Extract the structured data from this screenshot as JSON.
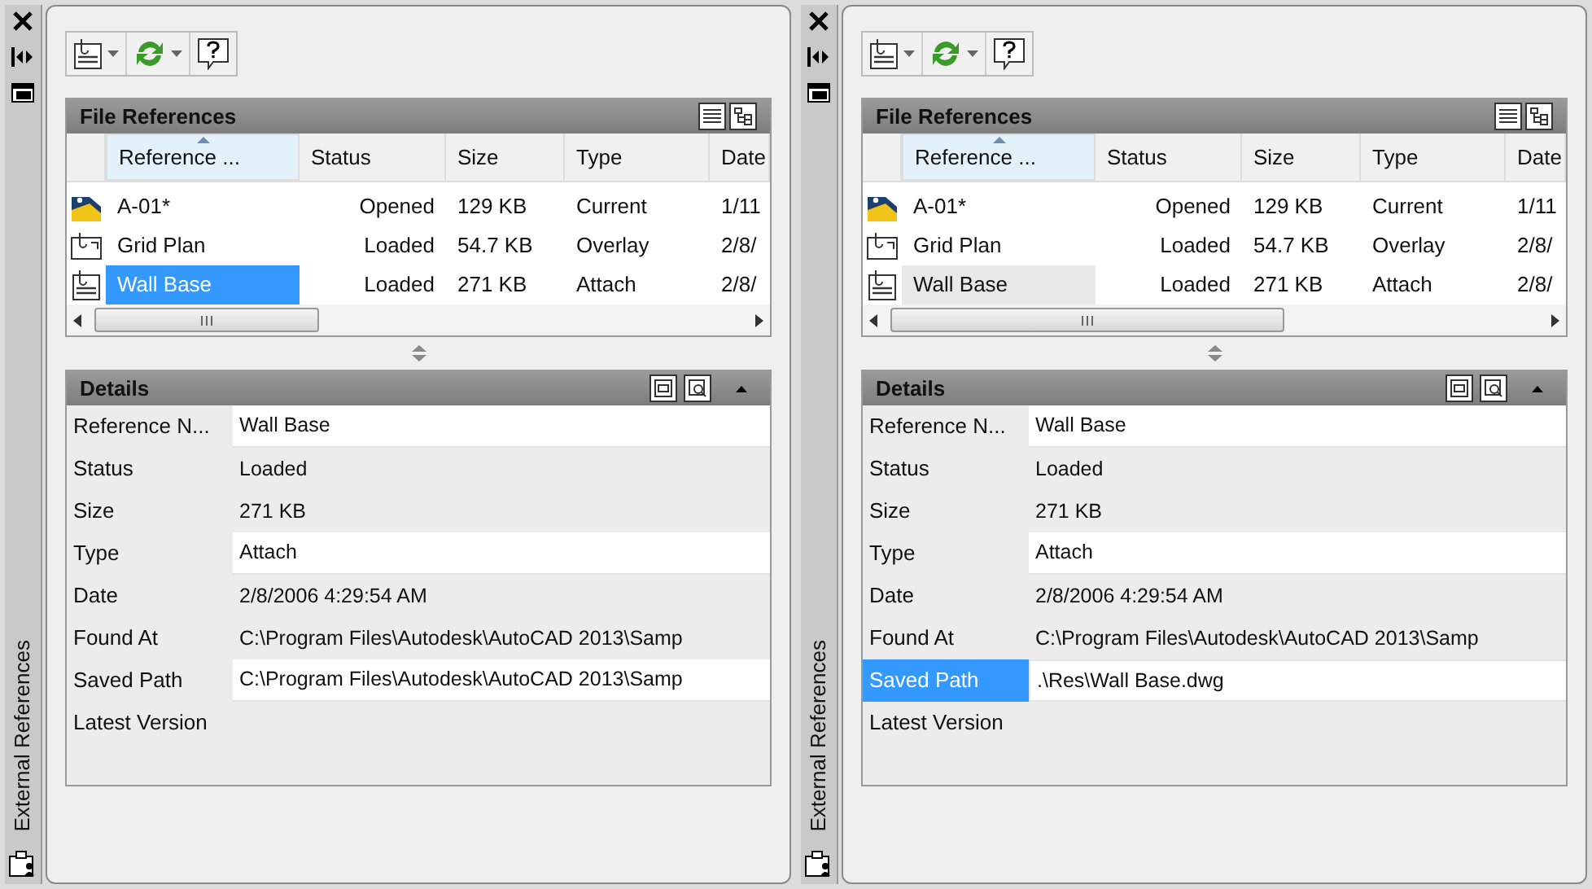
{
  "panels": [
    {
      "strip_title": "External References",
      "file_references": {
        "title": "File References",
        "focused": true,
        "columns": [
          "Reference ...",
          "Status",
          "Size",
          "Type",
          "Date"
        ],
        "rows": [
          {
            "kind": "current",
            "cells": [
              "A-01*",
              "Opened",
              "129 KB",
              "Current",
              "1/11"
            ],
            "selected": false
          },
          {
            "kind": "overlay",
            "cells": [
              "Grid Plan",
              "Loaded",
              "54.7 KB",
              "Overlay",
              "2/8/"
            ],
            "selected": false
          },
          {
            "kind": "attach",
            "cells": [
              "Wall Base",
              "Loaded",
              "271 KB",
              "Attach",
              "2/8/"
            ],
            "selected": true
          }
        ]
      },
      "details": {
        "title": "Details",
        "rows": [
          {
            "label": "Reference N...",
            "value": "Wall Base",
            "editable": true,
            "selected": false
          },
          {
            "label": "Status",
            "value": "Loaded",
            "editable": false,
            "selected": false
          },
          {
            "label": "Size",
            "value": "271 KB",
            "editable": false,
            "selected": false
          },
          {
            "label": "Type",
            "value": "Attach",
            "editable": true,
            "selected": false
          },
          {
            "label": "Date",
            "value": "2/8/2006 4:29:54 AM",
            "editable": false,
            "selected": false
          },
          {
            "label": "Found At",
            "value": "C:\\Program Files\\Autodesk\\AutoCAD 2013\\Samp",
            "editable": false,
            "selected": false
          },
          {
            "label": "Saved Path",
            "value": "C:\\Program Files\\Autodesk\\AutoCAD 2013\\Samp",
            "editable": true,
            "selected": false
          },
          {
            "label": "Latest Version",
            "editable": false,
            "selected": false
          }
        ]
      }
    },
    {
      "strip_title": "External References",
      "file_references": {
        "title": "File References",
        "focused": false,
        "columns": [
          "Reference ...",
          "Status",
          "Size",
          "Type",
          "Date"
        ],
        "rows": [
          {
            "kind": "current",
            "cells": [
              "A-01*",
              "Opened",
              "129 KB",
              "Current",
              "1/11"
            ],
            "selected": false
          },
          {
            "kind": "overlay",
            "cells": [
              "Grid Plan",
              "Loaded",
              "54.7 KB",
              "Overlay",
              "2/8/"
            ],
            "selected": false
          },
          {
            "kind": "attach",
            "cells": [
              "Wall Base",
              "Loaded",
              "271 KB",
              "Attach",
              "2/8/"
            ],
            "selected": true
          }
        ]
      },
      "details": {
        "title": "Details",
        "rows": [
          {
            "label": "Reference N...",
            "value": "Wall Base",
            "editable": true,
            "selected": false
          },
          {
            "label": "Status",
            "value": "Loaded",
            "editable": false,
            "selected": false
          },
          {
            "label": "Size",
            "value": "271 KB",
            "editable": false,
            "selected": false
          },
          {
            "label": "Type",
            "value": "Attach",
            "editable": true,
            "selected": false
          },
          {
            "label": "Date",
            "value": "2/8/2006 4:29:54 AM",
            "editable": false,
            "selected": false
          },
          {
            "label": "Found At",
            "value": "C:\\Program Files\\Autodesk\\AutoCAD 2013\\Samp",
            "editable": false,
            "selected": false
          },
          {
            "label": "Saved Path",
            "value": ".\\Res\\Wall Base.dwg",
            "editable": true,
            "selected": true
          },
          {
            "label": "Latest Version",
            "editable": false,
            "selected": false
          }
        ]
      }
    }
  ]
}
